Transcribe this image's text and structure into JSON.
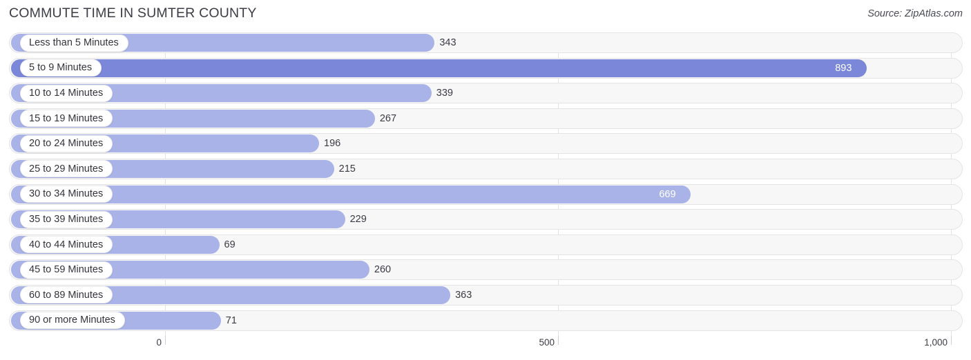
{
  "header": {
    "title": "COMMUTE TIME IN SUMTER COUNTY",
    "source": "Source: ZipAtlas.com"
  },
  "colors": {
    "bar": "#a9b3e8",
    "bar_max": "#7b87d8",
    "track": "#f7f7f8",
    "grid": "#e3e3e6",
    "label_text": "#33333a",
    "value_text": "#3a3a42",
    "value_text_inside": "#ffffff"
  },
  "chart_data": {
    "type": "bar",
    "orientation": "horizontal",
    "title": "COMMUTE TIME IN SUMTER COUNTY",
    "xlabel": "",
    "ylabel": "",
    "xlim": [
      0,
      1000
    ],
    "grid": true,
    "legend": null,
    "xticks": [
      0,
      500,
      1000
    ],
    "xtick_labels": [
      "0",
      "500",
      "1,000"
    ],
    "categories": [
      "Less than 5 Minutes",
      "5 to 9 Minutes",
      "10 to 14 Minutes",
      "15 to 19 Minutes",
      "20 to 24 Minutes",
      "25 to 29 Minutes",
      "30 to 34 Minutes",
      "35 to 39 Minutes",
      "40 to 44 Minutes",
      "45 to 59 Minutes",
      "60 to 89 Minutes",
      "90 or more Minutes"
    ],
    "values": [
      343,
      893,
      339,
      267,
      196,
      215,
      669,
      229,
      69,
      260,
      363,
      71
    ],
    "value_labels": [
      "343",
      "893",
      "339",
      "267",
      "196",
      "215",
      "669",
      "229",
      "69",
      "260",
      "363",
      "71"
    ],
    "highlight_index": 1
  },
  "rows": [
    {
      "label": "Less than 5 Minutes",
      "value": 343,
      "value_label": "343",
      "inside": false,
      "max": false
    },
    {
      "label": "5 to 9 Minutes",
      "value": 893,
      "value_label": "893",
      "inside": true,
      "max": true
    },
    {
      "label": "10 to 14 Minutes",
      "value": 339,
      "value_label": "339",
      "inside": false,
      "max": false
    },
    {
      "label": "15 to 19 Minutes",
      "value": 267,
      "value_label": "267",
      "inside": false,
      "max": false
    },
    {
      "label": "20 to 24 Minutes",
      "value": 196,
      "value_label": "196",
      "inside": false,
      "max": false
    },
    {
      "label": "25 to 29 Minutes",
      "value": 215,
      "value_label": "215",
      "inside": false,
      "max": false
    },
    {
      "label": "30 to 34 Minutes",
      "value": 669,
      "value_label": "669",
      "inside": true,
      "max": false
    },
    {
      "label": "35 to 39 Minutes",
      "value": 229,
      "value_label": "229",
      "inside": false,
      "max": false
    },
    {
      "label": "40 to 44 Minutes",
      "value": 69,
      "value_label": "69",
      "inside": false,
      "max": false
    },
    {
      "label": "45 to 59 Minutes",
      "value": 260,
      "value_label": "260",
      "inside": false,
      "max": false
    },
    {
      "label": "60 to 89 Minutes",
      "value": 363,
      "value_label": "363",
      "inside": false,
      "max": false
    },
    {
      "label": "90 or more Minutes",
      "value": 71,
      "value_label": "71",
      "inside": false,
      "max": false
    }
  ],
  "axis": {
    "ticks": [
      {
        "value": 0,
        "label": "0"
      },
      {
        "value": 500,
        "label": "500"
      },
      {
        "value": 1000,
        "label": "1,000"
      }
    ]
  }
}
